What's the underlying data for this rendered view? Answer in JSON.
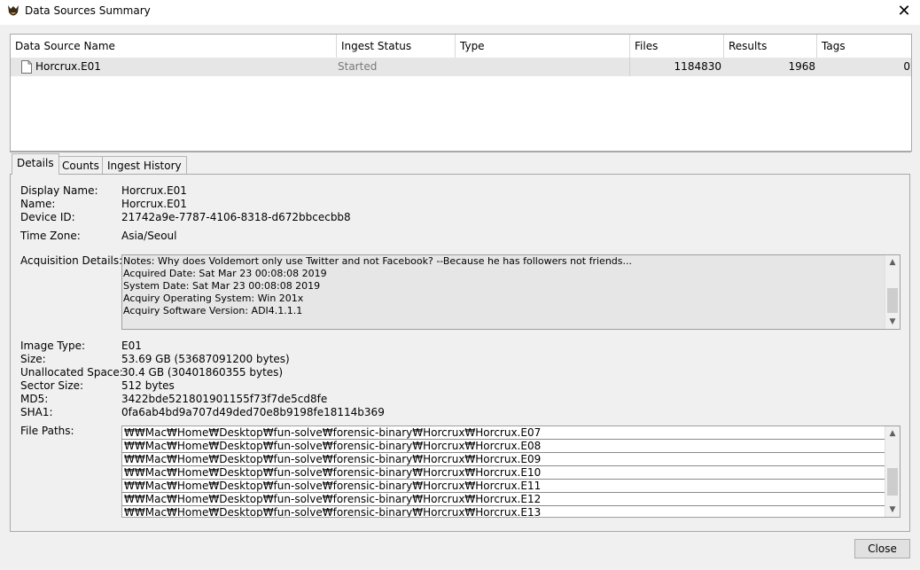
{
  "window": {
    "title": "Data Sources Summary",
    "close_glyph": "✕"
  },
  "table": {
    "columns": [
      "Data Source Name",
      "Ingest Status",
      "Type",
      "Files",
      "Results",
      "Tags"
    ],
    "rows": [
      {
        "name": "Horcrux.E01",
        "status": "Started",
        "type": "",
        "files": "1184830",
        "results": "1968",
        "tags": "0"
      }
    ]
  },
  "tabs": [
    "Details",
    "Counts",
    "Ingest History"
  ],
  "details": {
    "display_name_label": "Display Name:",
    "display_name": "Horcrux.E01",
    "name_label": "Name:",
    "name": "Horcrux.E01",
    "device_id_label": "Device ID:",
    "device_id": "21742a9e-7787-4106-8318-d672bbcecbb8",
    "time_zone_label": "Time Zone:",
    "time_zone": "Asia/Seoul",
    "acquisition_label": "Acquisition Details:",
    "acquisition_lines": [
      "Notes: Why does Voldemort only use Twitter and not Facebook? --Because he has followers not friends...",
      "Acquired Date: Sat Mar 23 00:08:08 2019",
      "System Date: Sat Mar 23 00:08:08 2019",
      "Acquiry Operating System: Win 201x",
      "Acquiry Software Version: ADI4.1.1.1"
    ],
    "image_type_label": "Image Type:",
    "image_type": "E01",
    "size_label": "Size:",
    "size": "53.69 GB (53687091200 bytes)",
    "unallocated_label": "Unallocated Space:",
    "unallocated": "30.4 GB (30401860355 bytes)",
    "sector_label": "Sector Size:",
    "sector": "512 bytes",
    "md5_label": "MD5:",
    "md5": "3422bde521801901155f73f7de5cd8fe",
    "sha1_label": "SHA1:",
    "sha1": "0fa6ab4bd9a707d49ded70e8b9198fe18114b369",
    "file_paths_label": "File Paths:",
    "file_paths": [
      "₩₩Mac₩Home₩Desktop₩fun-solve₩forensic-binary₩Horcrux₩Horcrux.E07",
      "₩₩Mac₩Home₩Desktop₩fun-solve₩forensic-binary₩Horcrux₩Horcrux.E08",
      "₩₩Mac₩Home₩Desktop₩fun-solve₩forensic-binary₩Horcrux₩Horcrux.E09",
      "₩₩Mac₩Home₩Desktop₩fun-solve₩forensic-binary₩Horcrux₩Horcrux.E10",
      "₩₩Mac₩Home₩Desktop₩fun-solve₩forensic-binary₩Horcrux₩Horcrux.E11",
      "₩₩Mac₩Home₩Desktop₩fun-solve₩forensic-binary₩Horcrux₩Horcrux.E12",
      "₩₩Mac₩Home₩Desktop₩fun-solve₩forensic-binary₩Horcrux₩Horcrux.E13"
    ]
  },
  "footer": {
    "close_label": "Close"
  }
}
